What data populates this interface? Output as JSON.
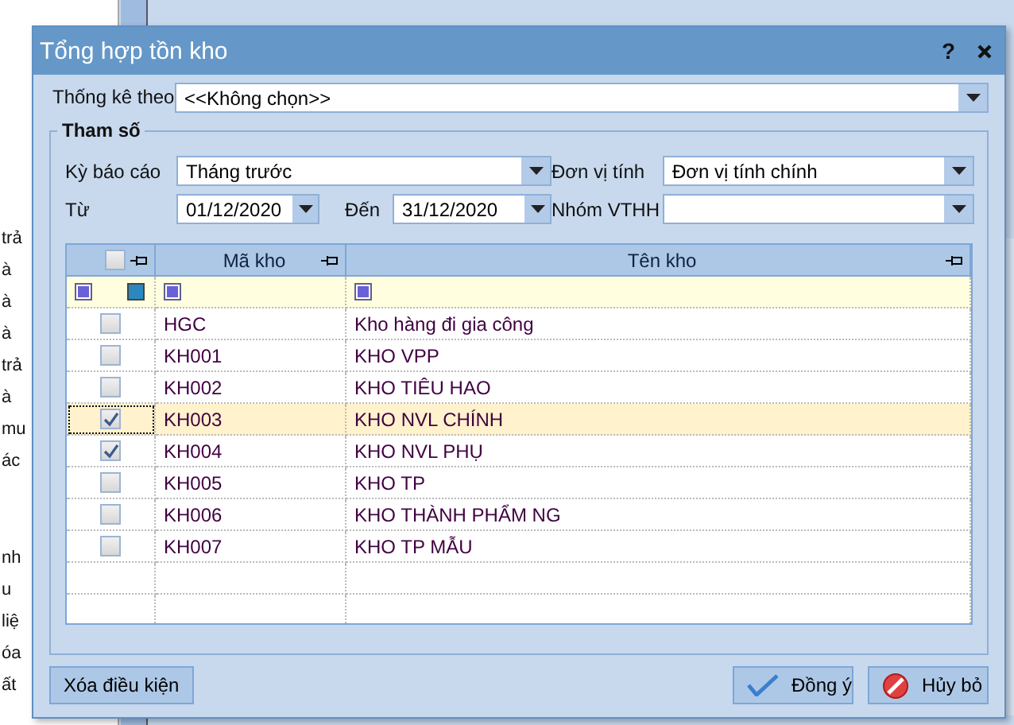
{
  "background": {
    "fragments": [
      "trả",
      "à",
      "à",
      "à",
      "trả",
      "à",
      "mu",
      "ác",
      "nh",
      "u",
      "liệ",
      "óa",
      "ất"
    ]
  },
  "dialog": {
    "title": "Tổng hợp tồn kho",
    "help": "?",
    "statistic_by": {
      "label": "Thống kê theo",
      "value": "<<Không chọn>>"
    },
    "params": {
      "title": "Tham số",
      "fields": [
        {
          "label": "Kỳ báo cáo",
          "value": "Tháng trước",
          "kind": "combo"
        },
        {
          "label": "Đơn vị tính",
          "value": "Đơn vị tính chính",
          "kind": "combo"
        },
        {
          "label": "Từ",
          "value": "01/12/2020",
          "kind": "date"
        },
        {
          "label": "Đến",
          "value": "31/12/2020",
          "kind": "date"
        },
        {
          "label": "Nhóm VTHH",
          "kind": "combo"
        }
      ]
    },
    "table": {
      "columns": [
        "Mã kho",
        "Tên kho"
      ],
      "header_checked": false,
      "rows": [
        {
          "code": "HGC",
          "name": "Kho hàng đi gia công",
          "checked": false,
          "selected": false
        },
        {
          "code": "KH001",
          "name": "KHO VPP",
          "checked": false,
          "selected": false
        },
        {
          "code": "KH002",
          "name": "KHO TIÊU HAO",
          "checked": false,
          "selected": false
        },
        {
          "code": "KH003",
          "name": "KHO NVL CHÍNH",
          "checked": true,
          "selected": true
        },
        {
          "code": "KH004",
          "name": "KHO NVL PHỤ",
          "checked": true,
          "selected": false
        },
        {
          "code": "KH005",
          "name": "KHO TP",
          "checked": false,
          "selected": false
        },
        {
          "code": "KH006",
          "name": "KHO THÀNH PHẨM NG",
          "checked": false,
          "selected": false
        },
        {
          "code": "KH007",
          "name": "KHO TP MẪU",
          "checked": false,
          "selected": false
        }
      ]
    },
    "buttons": [
      {
        "label": "Xóa điều kiện",
        "kind": "plain"
      },
      {
        "label": "Đồng ý",
        "kind": "ok"
      },
      {
        "label": "Hủy bỏ",
        "kind": "cancel"
      }
    ]
  }
}
